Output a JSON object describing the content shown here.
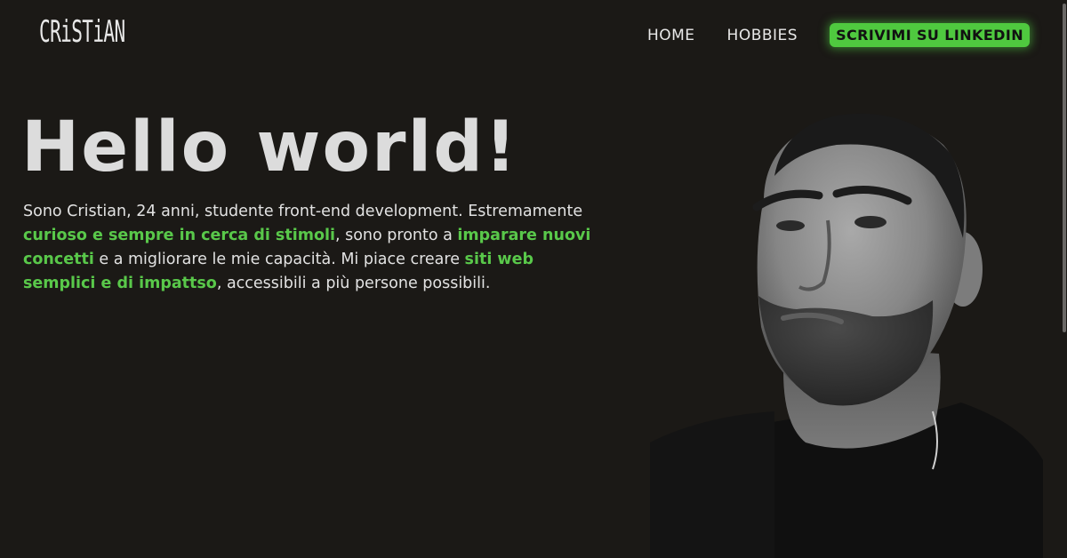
{
  "header": {
    "logo_text": "CRiSTiAN",
    "nav": [
      {
        "label": "HOME"
      },
      {
        "label": "HOBBIES"
      }
    ],
    "cta_label": "SCRIVIMI SU LINKEDIN"
  },
  "hero": {
    "title": "Hello world!",
    "paragraph": [
      {
        "text": "Sono Cristian, 24 anni, studente front-end development. Estremamente ",
        "highlight": false
      },
      {
        "text": "curioso e sempre in cerca di stimoli",
        "highlight": true
      },
      {
        "text": ", sono pronto a ",
        "highlight": false
      },
      {
        "text": "imparare nuovi concetti",
        "highlight": true
      },
      {
        "text": " e a migliorare le mie capacità. Mi piace creare ",
        "highlight": false
      },
      {
        "text": "siti web semplici e di impattso",
        "highlight": true
      },
      {
        "text": ", accessibili a più persone possibili.",
        "highlight": false
      }
    ]
  },
  "colors": {
    "background": "#1b1916",
    "accent": "#4fc93f",
    "highlight_text": "#59c84a",
    "title_text": "#dcdcdc"
  },
  "icons": {
    "portrait": "portrait-photo"
  }
}
